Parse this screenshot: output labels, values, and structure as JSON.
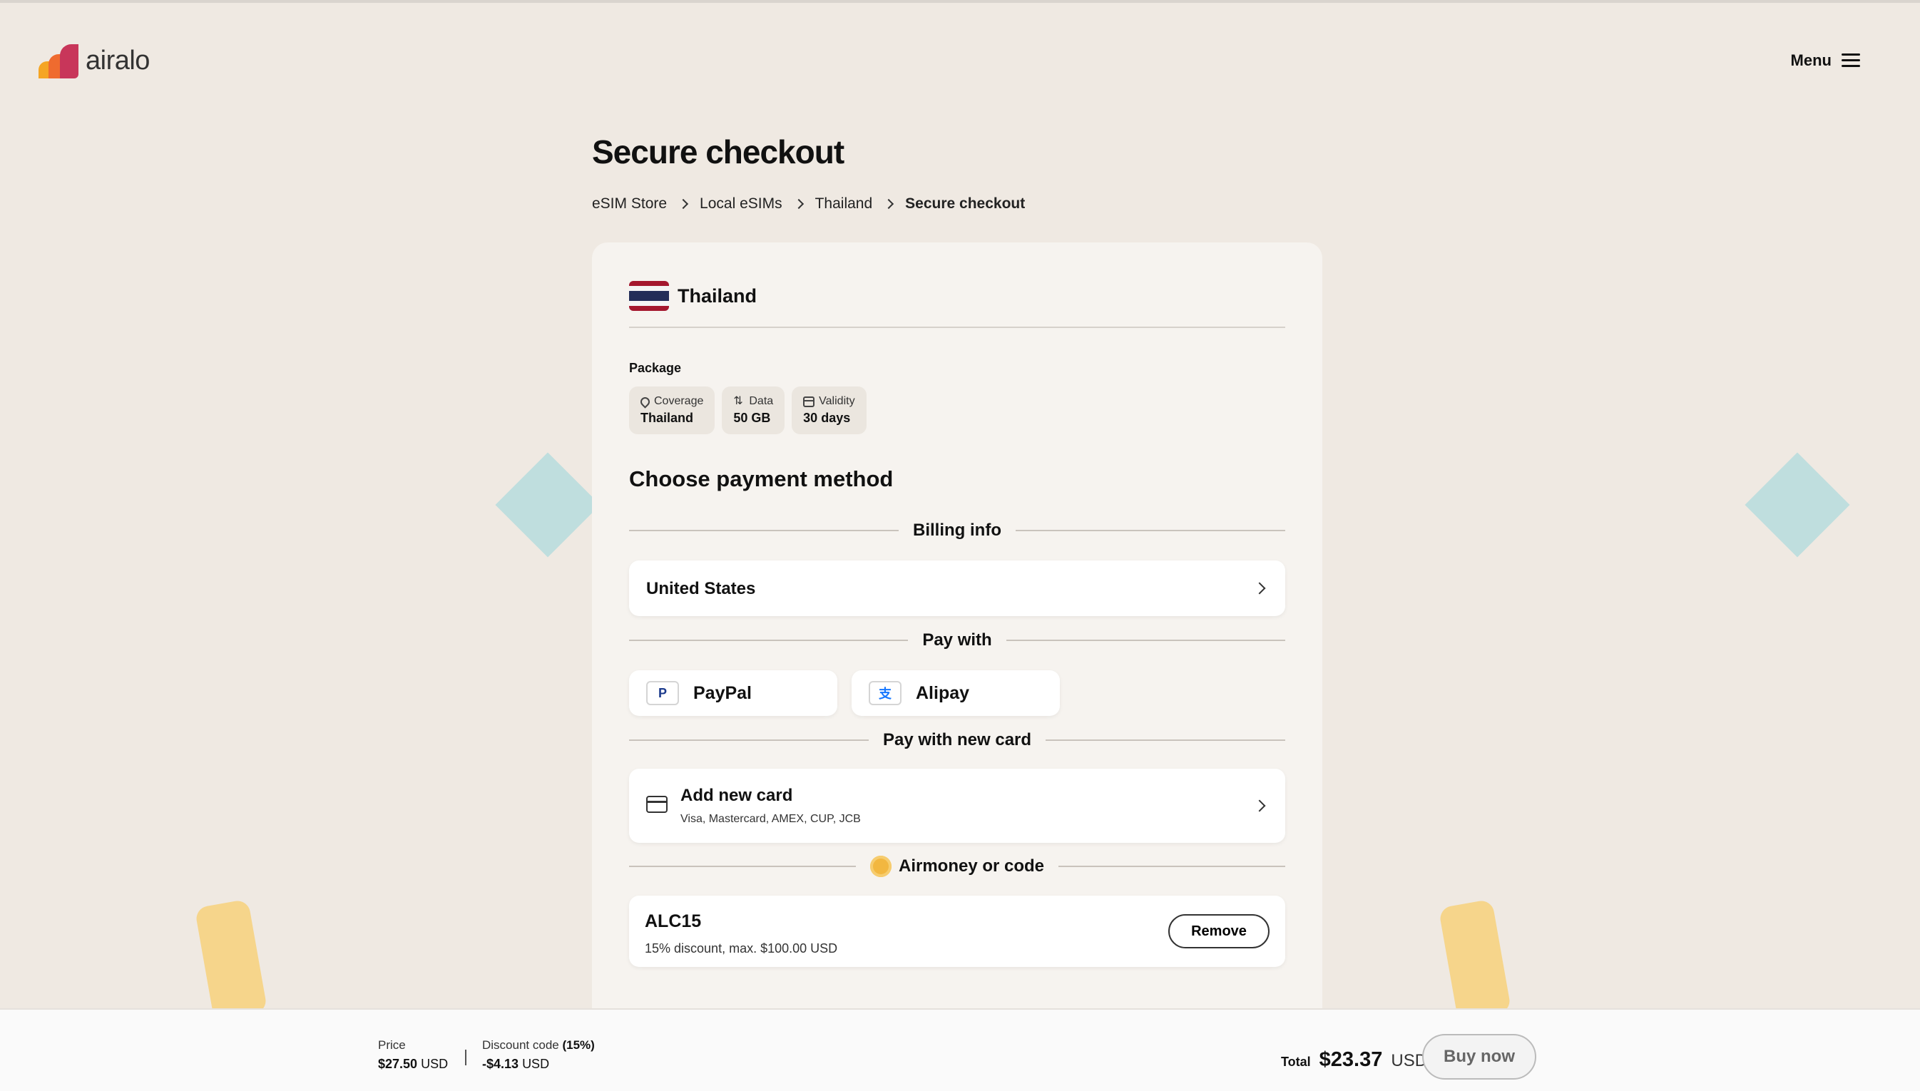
{
  "brand": {
    "name": "airalo"
  },
  "header": {
    "menu_label": "Menu"
  },
  "page": {
    "title": "Secure checkout"
  },
  "breadcrumb": [
    "eSIM Store",
    "Local eSIMs",
    "Thailand",
    "Secure checkout"
  ],
  "country": {
    "name": "Thailand"
  },
  "package": {
    "label": "Package",
    "chips": [
      {
        "icon": "pin-icon",
        "label": "Coverage",
        "value": "Thailand"
      },
      {
        "icon": "arrows-icon",
        "label": "Data",
        "value": "50 GB"
      },
      {
        "icon": "calendar-icon",
        "label": "Validity",
        "value": "30 days"
      }
    ]
  },
  "payment": {
    "title": "Choose payment method",
    "billing_info_label": "Billing info",
    "billing_country": "United States",
    "pay_with_label": "Pay with",
    "methods": [
      {
        "name": "PayPal",
        "icon_glyph": "P"
      },
      {
        "name": "Alipay",
        "icon_glyph": "支"
      }
    ],
    "new_card_label": "Pay with new card",
    "add_card_title": "Add new card",
    "add_card_subtitle": "Visa, Mastercard, AMEX, CUP, JCB",
    "airmoney_label": "Airmoney or code",
    "promo": {
      "code": "ALC15",
      "description": "15% discount, max. $100.00 USD",
      "remove_label": "Remove"
    }
  },
  "footer": {
    "price_label": "Price",
    "price_value": "$27.50",
    "price_currency": "USD",
    "discount_label": "Discount code",
    "discount_pct": "(15%)",
    "discount_value": "-$4.13",
    "discount_currency": "USD",
    "total_label": "Total",
    "total_value": "$23.37",
    "total_currency": "USD",
    "buy_label": "Buy now"
  },
  "colors": {
    "background": "#efe9e2",
    "card": "#f6f3ef",
    "brand_orange": "#ef6b2f",
    "brand_red": "#c8365a",
    "brand_yellow": "#f5a524"
  }
}
